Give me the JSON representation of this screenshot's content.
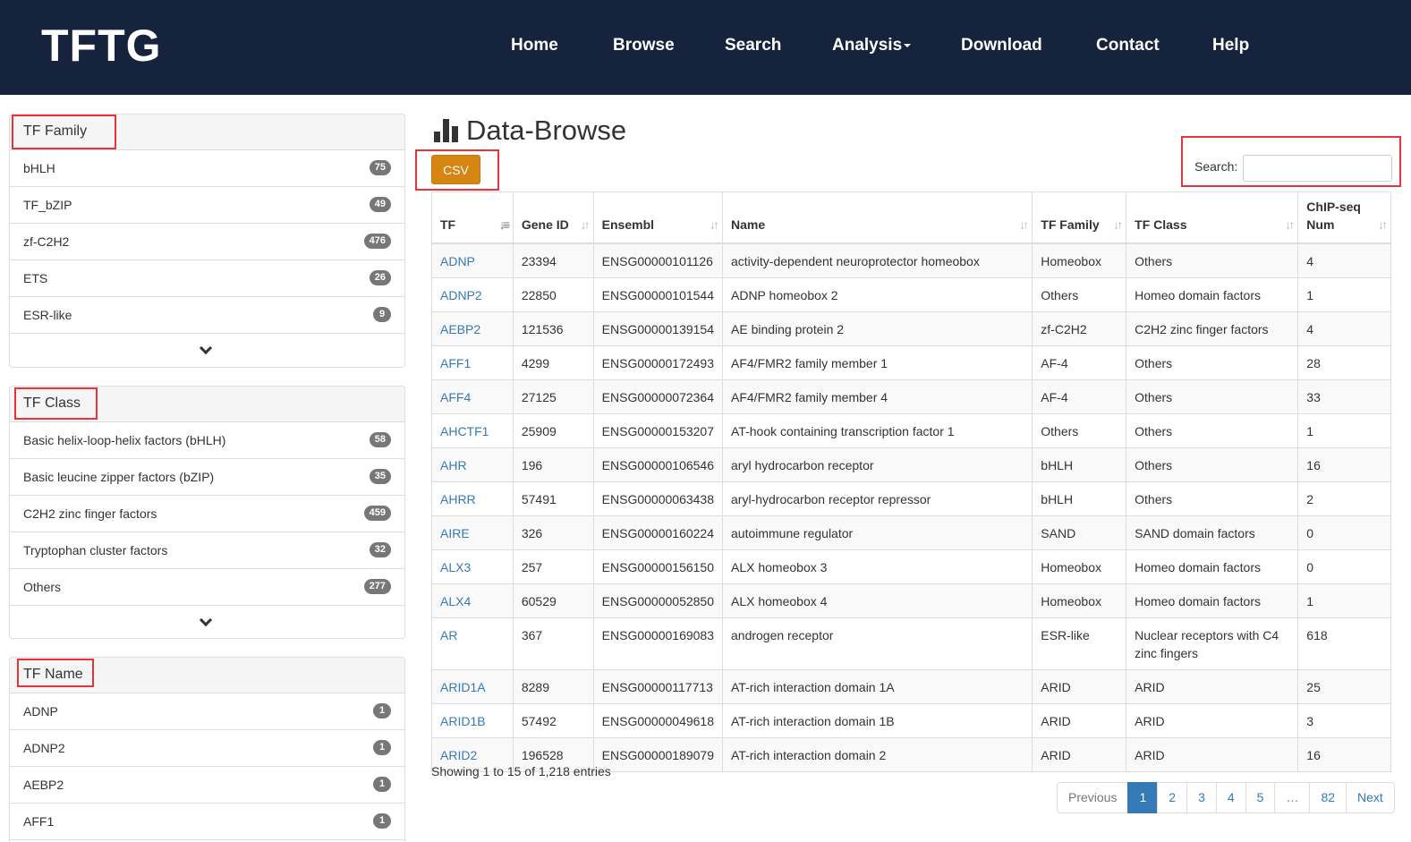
{
  "brand": "TFTG",
  "nav": {
    "home": "Home",
    "browse": "Browse",
    "search": "Search",
    "analysis": "Analysis",
    "download": "Download",
    "contact": "Contact",
    "help": "Help"
  },
  "sidebar": {
    "tf_family": {
      "title": "TF Family",
      "items": [
        {
          "label": "bHLH",
          "count": "75"
        },
        {
          "label": "TF_bZIP",
          "count": "49"
        },
        {
          "label": "zf-C2H2",
          "count": "476"
        },
        {
          "label": "ETS",
          "count": "26"
        },
        {
          "label": "ESR-like",
          "count": "9"
        }
      ]
    },
    "tf_class": {
      "title": "TF Class",
      "items": [
        {
          "label": "Basic helix-loop-helix factors (bHLH)",
          "count": "58"
        },
        {
          "label": "Basic leucine zipper factors (bZIP)",
          "count": "35"
        },
        {
          "label": "C2H2 zinc finger factors",
          "count": "459"
        },
        {
          "label": "Tryptophan cluster factors",
          "count": "32"
        },
        {
          "label": "Others",
          "count": "277"
        }
      ]
    },
    "tf_name": {
      "title": "TF Name",
      "items": [
        {
          "label": "ADNP",
          "count": "1"
        },
        {
          "label": "ADNP2",
          "count": "1"
        },
        {
          "label": "AEBP2",
          "count": "1"
        },
        {
          "label": "AFF1",
          "count": "1"
        }
      ]
    }
  },
  "main": {
    "title": "Data-Browse",
    "csv_label": "CSV",
    "search_label": "Search:",
    "search_value": "",
    "columns": [
      "TF",
      "Gene ID",
      "Ensembl",
      "Name",
      "TF Family",
      "TF Class",
      "ChIP-seq Num"
    ],
    "rows": [
      [
        "ADNP",
        "23394",
        "ENSG00000101126",
        "activity-dependent neuroprotector homeobox",
        "Homeobox",
        "Others",
        "4"
      ],
      [
        "ADNP2",
        "22850",
        "ENSG00000101544",
        "ADNP homeobox 2",
        "Others",
        "Homeo domain factors",
        "1"
      ],
      [
        "AEBP2",
        "121536",
        "ENSG00000139154",
        "AE binding protein 2",
        "zf-C2H2",
        "C2H2 zinc finger factors",
        "4"
      ],
      [
        "AFF1",
        "4299",
        "ENSG00000172493",
        "AF4/FMR2 family member 1",
        "AF-4",
        "Others",
        "28"
      ],
      [
        "AFF4",
        "27125",
        "ENSG00000072364",
        "AF4/FMR2 family member 4",
        "AF-4",
        "Others",
        "33"
      ],
      [
        "AHCTF1",
        "25909",
        "ENSG00000153207",
        "AT-hook containing transcription factor 1",
        "Others",
        "Others",
        "1"
      ],
      [
        "AHR",
        "196",
        "ENSG00000106546",
        "aryl hydrocarbon receptor",
        "bHLH",
        "Others",
        "16"
      ],
      [
        "AHRR",
        "57491",
        "ENSG00000063438",
        "aryl-hydrocarbon receptor repressor",
        "bHLH",
        "Others",
        "2"
      ],
      [
        "AIRE",
        "326",
        "ENSG00000160224",
        "autoimmune regulator",
        "SAND",
        "SAND domain factors",
        "0"
      ],
      [
        "ALX3",
        "257",
        "ENSG00000156150",
        "ALX homeobox 3",
        "Homeobox",
        "Homeo domain factors",
        "0"
      ],
      [
        "ALX4",
        "60529",
        "ENSG00000052850",
        "ALX homeobox 4",
        "Homeobox",
        "Homeo domain factors",
        "1"
      ],
      [
        "AR",
        "367",
        "ENSG00000169083",
        "androgen receptor",
        "ESR-like",
        "Nuclear receptors with C4 zinc fingers",
        "618"
      ],
      [
        "ARID1A",
        "8289",
        "ENSG00000117713",
        "AT-rich interaction domain 1A",
        "ARID",
        "ARID",
        "25"
      ],
      [
        "ARID1B",
        "57492",
        "ENSG00000049618",
        "AT-rich interaction domain 1B",
        "ARID",
        "ARID",
        "3"
      ],
      [
        "ARID2",
        "196528",
        "ENSG00000189079",
        "AT-rich interaction domain 2",
        "ARID",
        "ARID",
        "16"
      ]
    ],
    "info": "Showing 1 to 15 of 1,218 entries",
    "pagination": [
      "Previous",
      "1",
      "2",
      "3",
      "4",
      "5",
      "…",
      "82",
      "Next"
    ]
  },
  "colors": {
    "navbar": "#16233c",
    "csv_button": "#d58512",
    "link": "#337ab7",
    "highlight": "#e8333a",
    "badge": "#777777"
  }
}
